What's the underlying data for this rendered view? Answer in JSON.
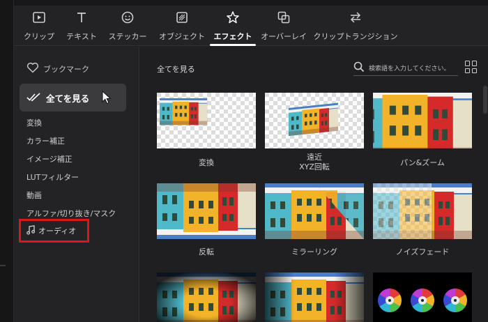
{
  "tabs": [
    {
      "label": "クリップ",
      "icon": "clip-icon"
    },
    {
      "label": "テキスト",
      "icon": "text-icon"
    },
    {
      "label": "ステッカー",
      "icon": "sticker-icon"
    },
    {
      "label": "オブジェクト",
      "icon": "object-icon"
    },
    {
      "label": "エフェクト",
      "icon": "effect-star-icon",
      "active": true
    },
    {
      "label": "オーバーレイ",
      "icon": "overlay-icon"
    },
    {
      "label": "クリップトランジション",
      "icon": "transition-icon"
    }
  ],
  "sidebar": {
    "bookmark": "ブックマーク",
    "all": "全てを見る",
    "categories": [
      "変換",
      "カラー補正",
      "イメージ補正",
      "LUTフィルター",
      "動画",
      "アルファ/切り抜き/マスク"
    ],
    "audio": "オーディオ"
  },
  "main": {
    "title": "全てを見る",
    "search_placeholder": "検索語を入力してください。"
  },
  "effects": [
    {
      "label": "変換"
    },
    {
      "label": "遠近",
      "label2": "XYZ回転"
    },
    {
      "label": "パン&ズーム"
    },
    {
      "label": "反転"
    },
    {
      "label": "ミラーリング"
    },
    {
      "label": "ノイズフェード"
    }
  ],
  "colors": {
    "highlight_box": "#e0151b",
    "selected_bg": "#3b3b3e",
    "panel_bg": "#1f1f21"
  }
}
